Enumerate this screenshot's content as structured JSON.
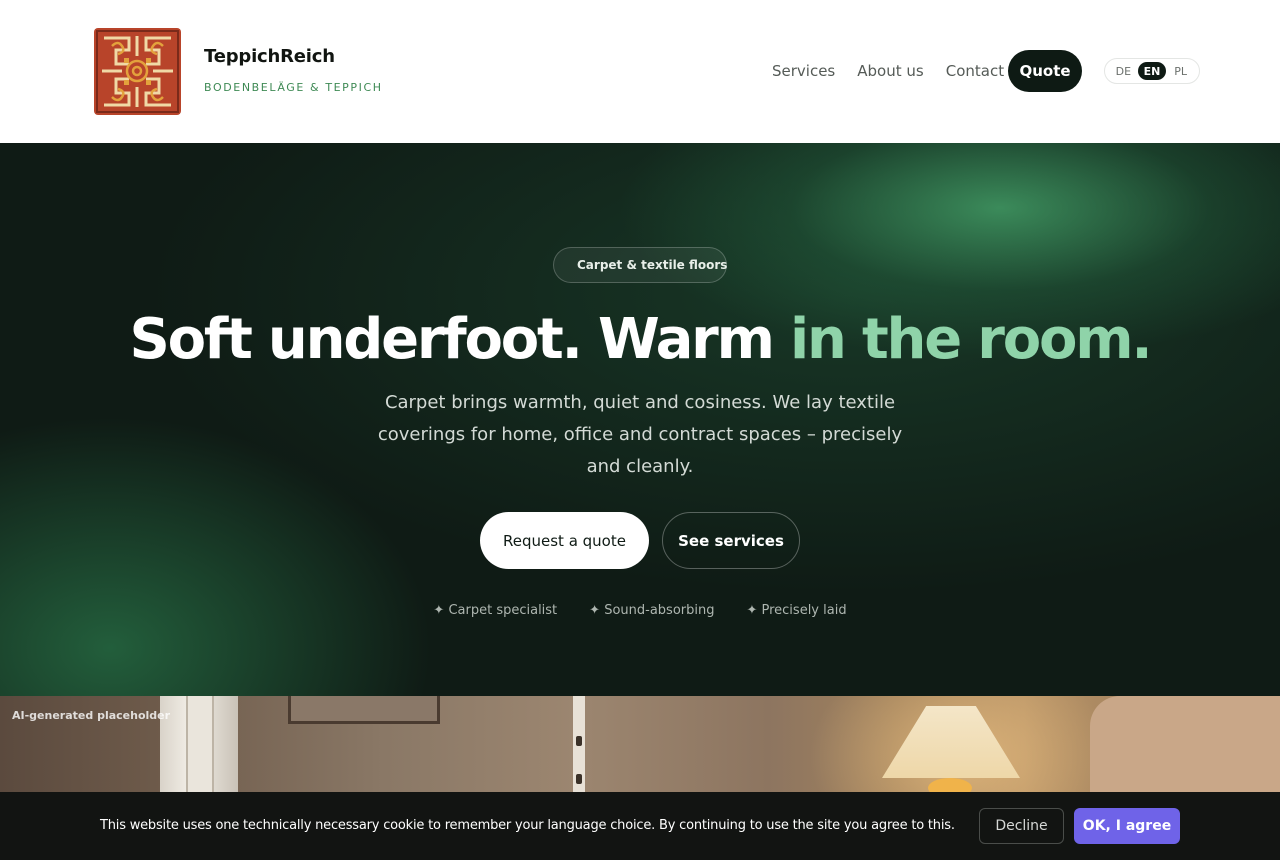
{
  "header": {
    "brand_name": "TeppichReich",
    "brand_tagline": "BODENBELÄGE & TEPPICH",
    "logo_icon": "carpet-pattern-logo",
    "nav": [
      "Services",
      "About us",
      "Contact"
    ],
    "quote_label": "Quote",
    "languages": [
      "DE",
      "EN",
      "PL"
    ],
    "active_language": "EN"
  },
  "hero": {
    "badge": "Carpet & textile floors",
    "headline_white": "Soft underfoot. Warm ",
    "headline_green": "in the room.",
    "subtext": "Carpet brings warmth, quiet and cosiness. We lay textile coverings for home, office and contract spaces – precisely and cleanly.",
    "primary_button": "Request a quote",
    "secondary_button": "See services",
    "features": [
      "✦ Carpet specialist",
      "✦ Sound-absorbing",
      "✦ Precisely laid"
    ],
    "accent_color": "#8fd3a9"
  },
  "photo": {
    "caption": "AI-generated placeholder"
  },
  "cookie": {
    "text": "This website uses one technically necessary cookie to remember your language choice. By continuing to use the site you agree to this.",
    "decline_label": "Decline",
    "accept_label": "OK, I agree",
    "accept_color": "#6f63e8"
  }
}
